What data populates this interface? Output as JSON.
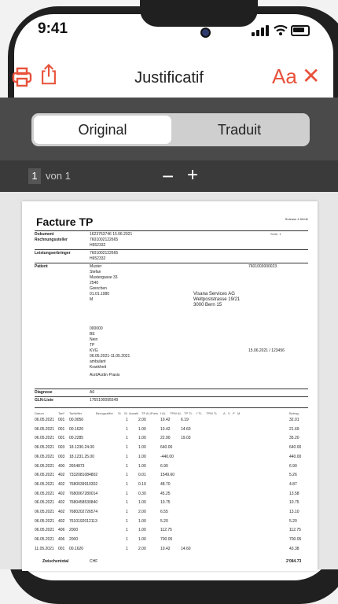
{
  "status": {
    "time": "9:41"
  },
  "toolbar": {
    "title": "Justificatif",
    "font_label": "Aa",
    "close_label": "✕",
    "print_icon": "printer-icon",
    "share_icon": "share-icon"
  },
  "segment": {
    "original": "Original",
    "translated": "Traduit",
    "selected": "Original"
  },
  "pager": {
    "page": "1",
    "of_label": "von 1",
    "minus": "−",
    "plus": "+"
  },
  "document": {
    "title": "Facture TP",
    "release": "Release 4.50/dfr",
    "patient": {
      "name": "Muster",
      "vorname": "Stefan",
      "strasse": "Mustergasse 33",
      "plz": "2540",
      "ort": "Grenchen",
      "geburtsdatum": "01.01.1980",
      "geschlecht": "M",
      "versicherten_nr": "000000",
      "kanton": "BE",
      "kopie": "Nein",
      "vergutungsart": "TP",
      "gesetz": "KVG",
      "behandlung": "06.05.2021-11.05.2021",
      "behandlungsart": "ambulant",
      "behandlungsgrund": "Krankheit",
      "rolle": "Arzt/Arztin  Praxis"
    },
    "recipient": {
      "line1": "Visana Services AG",
      "line2": "Weltpoststrasse 19/21",
      "line3": "3000 Bern 15",
      "gln": "7601003000023"
    },
    "rechnung": {
      "datum": "15.06.2021 / 123456"
    },
    "header_rows": [
      {
        "label": "Dokument",
        "id": "1623763746  15.06.2021",
        "seite": "Seite: 1"
      },
      {
        "label": "Rechnungssteller",
        "gln": "7601002122665",
        "zsr": "H652332"
      },
      {
        "label": "Leistungserbringer",
        "gln": "7601002122665",
        "zsr": "H652332"
      }
    ],
    "gln_liste": "1765100095549",
    "diagnose": "A6",
    "table_header": [
      "Datum",
      "Tarif",
      "Tarifziffer",
      "Bezugsziffer",
      "Si",
      "St",
      "Anzahl",
      "TP AL/Preis",
      "f AL",
      "TPW AL",
      "TP TL",
      "f TL",
      "TPW TL",
      "A",
      "V",
      "P",
      "M",
      "Betrag"
    ],
    "rows": [
      {
        "date": "06.05.2021",
        "tarif": "001",
        "code": "00.0050",
        "anz": "1",
        "tp": "2.00",
        "tpw": "10.42",
        "tl": "6.19",
        "amount": "32.01"
      },
      {
        "date": "06.05.2021",
        "tarif": "001",
        "code": "00.1620",
        "anz": "1",
        "tp": "1.00",
        "tpw": "10.42",
        "tl": "14.60",
        "amount": "21.69"
      },
      {
        "date": "06.05.2021",
        "tarif": "001",
        "code": "00.2285",
        "anz": "1",
        "tp": "1.00",
        "tpw": "22.90",
        "tl": "19.03",
        "amount": "35.20"
      },
      {
        "date": "06.05.2021",
        "tarif": "003",
        "code": "18.1230.24.00",
        "anz": "1",
        "tp": "1.00",
        "tpw": "640.00",
        "tl": "",
        "amount": "640.00"
      },
      {
        "date": "06.05.2021",
        "tarif": "003",
        "code": "18.1231.25.00",
        "anz": "1",
        "tp": "1.00",
        "tpw": "-440.00",
        "tl": "",
        "amount": "440.00"
      },
      {
        "date": "06.05.2021",
        "tarif": "400",
        "code": "2654873",
        "anz": "1",
        "tp": "1.00",
        "tpw": "6.90",
        "tl": "",
        "amount": "6.90"
      },
      {
        "date": "06.05.2021",
        "tarif": "402",
        "code": "7332081084802",
        "anz": "1",
        "tp": "0.01",
        "tpw": "1549.60",
        "tl": "",
        "amount": "5.26"
      },
      {
        "date": "06.05.2021",
        "tarif": "402",
        "code": "7680039910302",
        "anz": "1",
        "tp": "0.10",
        "tpw": "48.70",
        "tl": "",
        "amount": "4.87"
      },
      {
        "date": "06.05.2021",
        "tarif": "402",
        "code": "7680067280014",
        "anz": "1",
        "tp": "0.30",
        "tpw": "45.25",
        "tl": "",
        "amount": "13.58"
      },
      {
        "date": "06.05.2021",
        "tarif": "402",
        "code": "7680458530840",
        "anz": "1",
        "tp": "1.00",
        "tpw": "10.75",
        "tl": "",
        "amount": "10.75"
      },
      {
        "date": "06.05.2021",
        "tarif": "402",
        "code": "7680202726574",
        "anz": "1",
        "tp": "2.00",
        "tpw": "6.55",
        "tl": "",
        "amount": "13.10"
      },
      {
        "date": "06.05.2021",
        "tarif": "402",
        "code": "7610192012113",
        "anz": "1",
        "tp": "1.00",
        "tpw": "5.20",
        "tl": "",
        "amount": "5.20"
      },
      {
        "date": "06.05.2021",
        "tarif": "406",
        "code": "2000",
        "anz": "1",
        "tp": "1.00",
        "tpw": "112.75",
        "tl": "",
        "amount": "112.75"
      },
      {
        "date": "06.05.2021",
        "tarif": "406",
        "code": "2000",
        "anz": "1",
        "tp": "1.00",
        "tpw": "700.05",
        "tl": "",
        "amount": "700.05"
      },
      {
        "date": "11.05.2021",
        "tarif": "001",
        "code": "00.1620",
        "anz": "1",
        "tp": "2.00",
        "tpw": "10.42",
        "tl": "14.60",
        "amount": "43.38"
      }
    ],
    "total_label": "Zwischentotal",
    "currency": "CHF",
    "total": "2'084.73"
  }
}
